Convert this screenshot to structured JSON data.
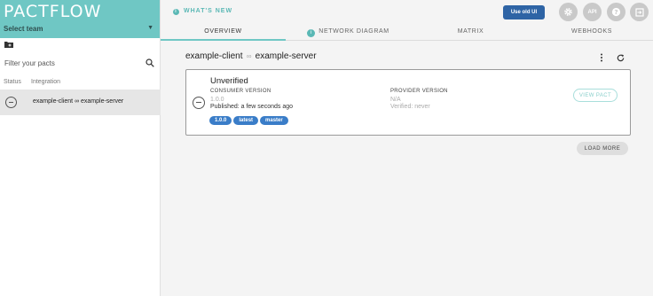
{
  "app": {
    "logo_text": "PACTFLOW"
  },
  "sidebar": {
    "team_select": "Select team",
    "filter_placeholder": "Filter your pacts",
    "columns": {
      "status": "Status",
      "integration": "Integration"
    },
    "items": [
      {
        "label": "example-client ∞ example-server"
      }
    ]
  },
  "topbar": {
    "whats_new": "WHAT'S NEW",
    "old_ui_button": "Use old UI",
    "api_label": "API"
  },
  "tabs": [
    {
      "label": "OVERVIEW"
    },
    {
      "label": "NETWORK DIAGRAM"
    },
    {
      "label": "MATRIX"
    },
    {
      "label": "WEBHOOKS"
    }
  ],
  "main": {
    "consumer": "example-client",
    "provider": "example-server",
    "card": {
      "status": "Unverified",
      "consumer_version_label": "CONSUMER VERSION",
      "consumer_version": "1.0.0",
      "published": "Published: a few seconds ago",
      "tags": [
        "1.0.0",
        "latest",
        "master"
      ],
      "provider_version_label": "PROVIDER VERSION",
      "provider_version": "N/A",
      "verified": "Verified: never",
      "view_pact_button": "VIEW PACT"
    },
    "load_more_button": "LOAD MORE"
  },
  "colors": {
    "brand": "#6fc7c4",
    "primary_button": "#2e64a5",
    "tag": "#3a7dc8",
    "icon_button": "#c9c9c9"
  },
  "icons": {
    "folder_add": "folder-add-icon",
    "search": "search-icon",
    "settings": "gear-icon",
    "help": "question-icon",
    "logout": "logout-icon",
    "info": "info-icon",
    "link": "link-icon",
    "more": "kebab-icon",
    "refresh": "refresh-icon"
  }
}
